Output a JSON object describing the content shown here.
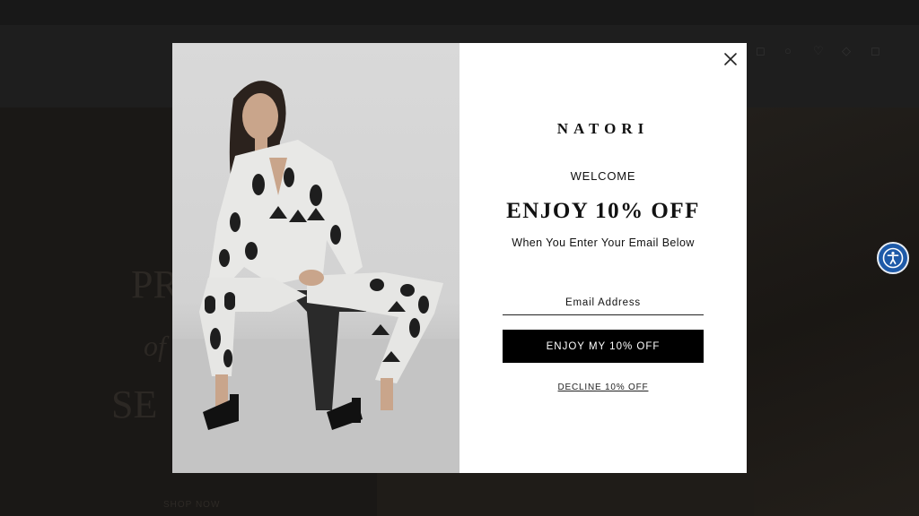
{
  "background": {
    "promo_bar": "",
    "hero": {
      "line1": "PR",
      "line2": "of",
      "line3": "SE",
      "link": "SHOP NOW"
    }
  },
  "modal": {
    "brand": "NATORI",
    "welcome": "WELCOME",
    "headline": "ENJOY 10% OFF",
    "subtext": "When You Enter Your Email Below",
    "email_placeholder": "Email Address",
    "email_value": "",
    "submit_label": "ENJOY MY 10% OFF",
    "decline_label": "DECLINE 10% OFF",
    "close_icon": "close-icon",
    "image_icon": "model-photo"
  },
  "accessibility": {
    "icon": "accessibility-icon",
    "color": "#1e5aa8"
  },
  "colors": {
    "overlay": "#1c1b1a",
    "button_bg": "#000000",
    "modal_bg": "#ffffff"
  }
}
